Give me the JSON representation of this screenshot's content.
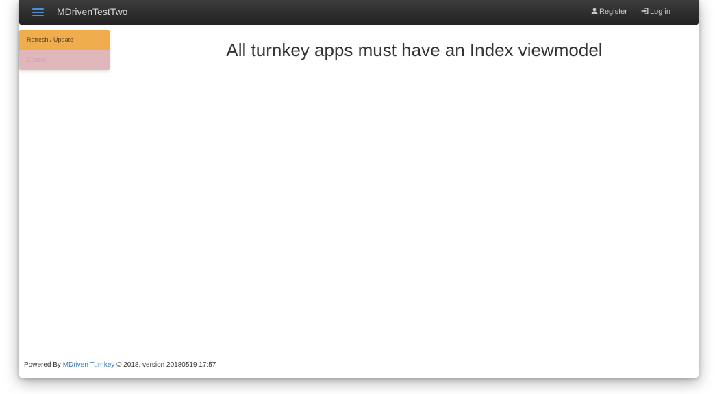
{
  "navbar": {
    "brand": "MDrivenTestTwo",
    "register_label": "Register",
    "login_label": "Log in"
  },
  "actions": {
    "refresh_label": "Refresh / Update",
    "cancel_label": "Cancel"
  },
  "main": {
    "title": "All turnkey apps must have an Index viewmodel"
  },
  "footer": {
    "prefix": "Powered By",
    "link_text": "MDriven Turnkey",
    "suffix": "© 2018, version 20180519 17:57"
  },
  "icons": {
    "menu": "hamburger-menu-icon",
    "register": "user-icon",
    "login": "log-in-icon"
  },
  "colors": {
    "navbar": "#222222",
    "accent": "#4a90d9",
    "refresh_button": "#f0ad4e",
    "cancel_button": "#e0b8bc",
    "link": "#337ab7"
  }
}
